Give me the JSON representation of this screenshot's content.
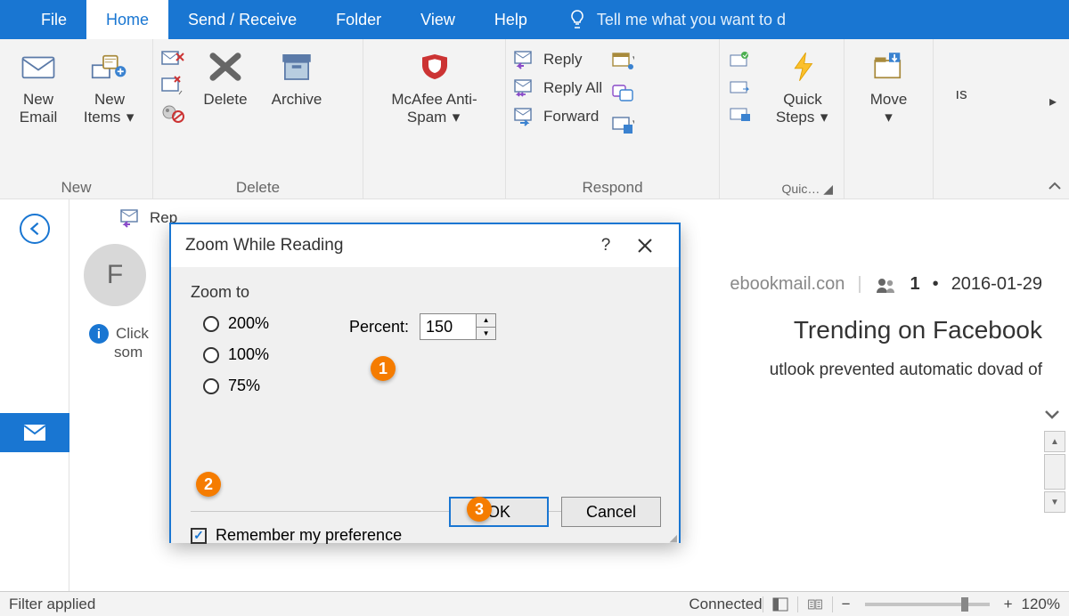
{
  "tabs": {
    "file": "File",
    "home": "Home",
    "send_receive": "Send / Receive",
    "folder": "Folder",
    "view": "View",
    "help": "Help",
    "tellme": "Tell me what you want to d"
  },
  "ribbon": {
    "new": {
      "group": "New",
      "new_email": "New\nEmail",
      "new_items": "New\nItems"
    },
    "delete": {
      "group": "Delete",
      "delete": "Delete",
      "archive": "Archive"
    },
    "mcafee": {
      "label": "McAfee Anti-\nSpam"
    },
    "respond": {
      "group": "Respond",
      "reply": "Reply",
      "reply_all": "Reply All",
      "forward": "Forward"
    },
    "quicksteps": {
      "label": "Quick\nSteps",
      "group": "Quic…"
    },
    "move": {
      "label": "Move"
    },
    "tags": {
      "label": "ıs"
    }
  },
  "preview": {
    "reply_short": "Rep",
    "avatar_letter": "F",
    "info_line": "Click",
    "info_line2": "som",
    "sender_frag": "ebookmail.con",
    "date": "2016-01-29",
    "count": "1",
    "subject": "Trending on Facebook",
    "blocked_msg": "utlook prevented automatic dovad of"
  },
  "dialog": {
    "title": "Zoom While Reading",
    "section": "Zoom to",
    "opt200": "200%",
    "opt100": "100%",
    "opt75": "75%",
    "percent_label": "Percent:",
    "percent_value": "150",
    "remember": "Remember my preference",
    "ok": "OK",
    "cancel": "Cancel"
  },
  "status": {
    "filter": "Filter applied",
    "connected": "Connected",
    "zoom": "120%"
  },
  "callouts": {
    "c1": "1",
    "c2": "2",
    "c3": "3"
  }
}
